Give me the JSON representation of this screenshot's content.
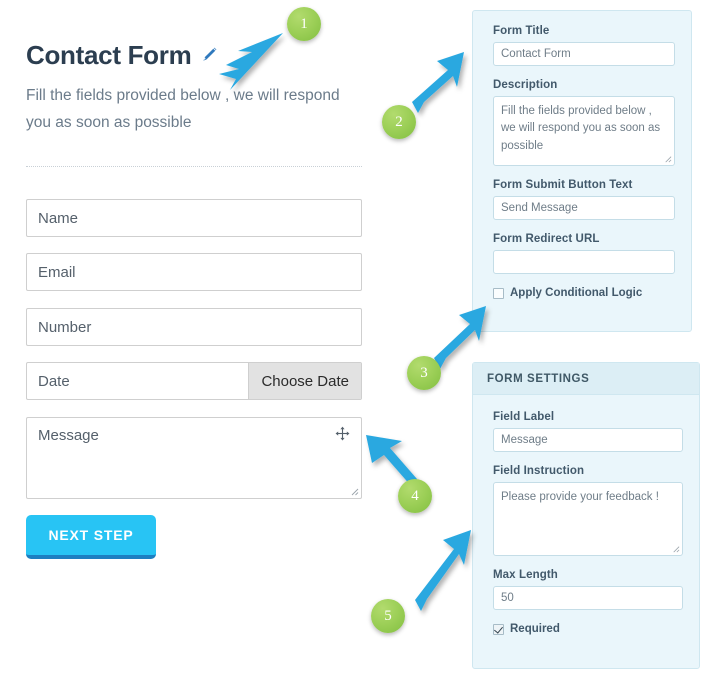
{
  "form_preview": {
    "title": "Contact Form",
    "edit_icon": "pencil-icon",
    "description": "Fill the fields provided below , we will respond you as soon as possible",
    "fields": [
      {
        "placeholder": "Name"
      },
      {
        "placeholder": "Email"
      },
      {
        "placeholder": "Number"
      },
      {
        "placeholder": "Date",
        "addon_label": "Choose Date"
      },
      {
        "placeholder": "Message",
        "icon": "move-cursor-icon"
      }
    ],
    "submit_button": {
      "label": "NEXT STEP",
      "color": "#28c4f4",
      "shadow_color": "#1d7fc1"
    }
  },
  "form_settings_panel": {
    "background": "#eaf6fb",
    "border": "#cfe7f0",
    "fields": [
      {
        "label": "Form Title",
        "value": "Contact Form",
        "type": "text"
      },
      {
        "label": "Description",
        "value": "Fill the fields provided below , we will respond you as soon as possible",
        "type": "textarea"
      },
      {
        "label": "Form Submit Button Text",
        "value": "Send Message",
        "type": "text"
      },
      {
        "label": "Form Redirect URL",
        "value": "",
        "type": "text"
      }
    ],
    "checkbox": {
      "label": "Apply Conditional Logic",
      "checked": false
    }
  },
  "field_settings_panel": {
    "header": "FORM SETTINGS",
    "header_background": "#dceef5",
    "fields": [
      {
        "label": "Field Label",
        "value": "Message",
        "type": "text"
      },
      {
        "label": "Field Instruction",
        "value": "Please provide your feedback !",
        "type": "textarea"
      },
      {
        "label": "Max Length",
        "value": "50",
        "type": "text"
      }
    ],
    "checkbox": {
      "label": "Required",
      "checked": true
    }
  },
  "callouts": {
    "badge_color": "#9ccf57",
    "arrow_color": "#29a8e0",
    "items": [
      {
        "number": "1"
      },
      {
        "number": "2"
      },
      {
        "number": "3"
      },
      {
        "number": "4"
      },
      {
        "number": "5"
      }
    ]
  }
}
